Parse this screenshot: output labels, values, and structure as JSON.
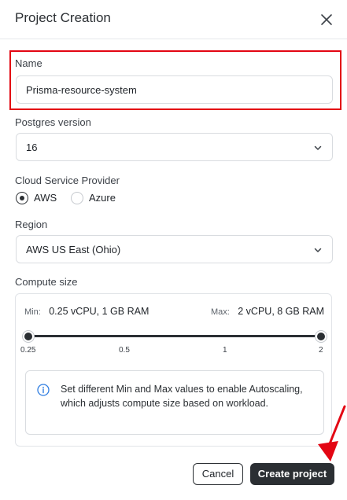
{
  "dialog": {
    "title": "Project Creation",
    "close_icon": "close-icon"
  },
  "name_field": {
    "label": "Name",
    "value": "Prisma-resource-system"
  },
  "postgres": {
    "label": "Postgres version",
    "value": "16"
  },
  "provider": {
    "label": "Cloud Service Provider",
    "options": [
      {
        "label": "AWS",
        "selected": true
      },
      {
        "label": "Azure",
        "selected": false
      }
    ]
  },
  "region": {
    "label": "Region",
    "value": "AWS US East (Ohio)"
  },
  "compute": {
    "label": "Compute size",
    "min_key": "Min:",
    "min_value": "0.25 vCPU, 1 GB RAM",
    "max_key": "Max:",
    "max_value": "2 vCPU, 8 GB RAM",
    "ticks": [
      "0.25",
      "0.5",
      "1",
      "2"
    ],
    "range_min": 0.25,
    "range_max": 2,
    "info_text": "Set different Min and Max values to enable Autoscaling, which adjusts compute size based on workload."
  },
  "buttons": {
    "cancel": "Cancel",
    "create": "Create project"
  },
  "colors": {
    "highlight": "#e30613",
    "primary": "#2b2f33"
  }
}
